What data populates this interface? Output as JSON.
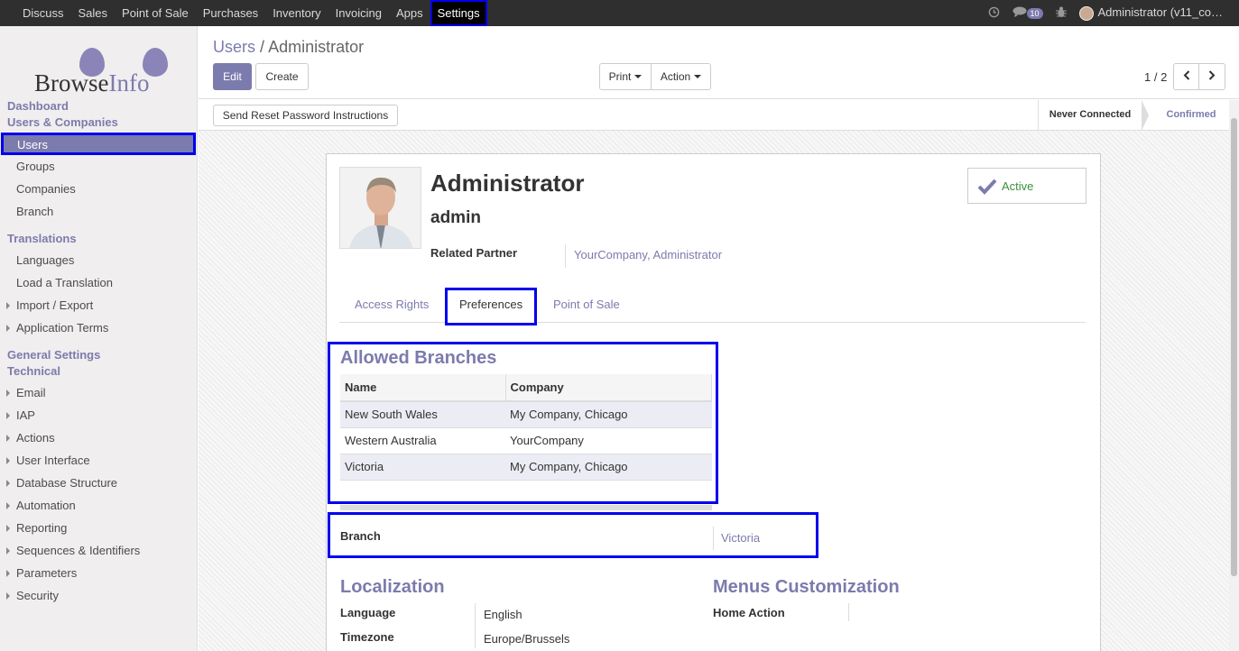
{
  "topbar": {
    "menu": [
      "Discuss",
      "Sales",
      "Point of Sale",
      "Purchases",
      "Inventory",
      "Invoicing",
      "Apps",
      "Settings"
    ],
    "active": "Settings",
    "message_count": "10",
    "user": "Administrator (v11_co…"
  },
  "logo": {
    "part1": "Browse",
    "part2": "Info"
  },
  "sidebar": {
    "dashboard": "Dashboard",
    "users_companies": "Users & Companies",
    "users": "Users",
    "groups": "Groups",
    "companies": "Companies",
    "branch": "Branch",
    "translations": "Translations",
    "languages": "Languages",
    "load_translation": "Load a Translation",
    "import_export": "Import / Export",
    "application_terms": "Application Terms",
    "general_settings": "General Settings",
    "technical": "Technical",
    "technical_items": [
      "Email",
      "IAP",
      "Actions",
      "User Interface",
      "Database Structure",
      "Automation",
      "Reporting",
      "Sequences & Identifiers",
      "Parameters",
      "Security"
    ]
  },
  "control_panel": {
    "breadcrumb_parent": "Users",
    "breadcrumb_sep": "/",
    "breadcrumb_current": "Administrator",
    "edit": "Edit",
    "create": "Create",
    "print": "Print",
    "action": "Action",
    "pager": "1 / 2"
  },
  "statusbar": {
    "reset_button": "Send Reset Password Instructions",
    "stage1": "Never Connected",
    "stage2": "Confirmed"
  },
  "form": {
    "name": "Administrator",
    "login": "admin",
    "related_partner_label": "Related Partner",
    "related_partner_value": "YourCompany, Administrator",
    "active_label": "Active",
    "tabs": [
      "Access Rights",
      "Preferences",
      "Point of Sale"
    ],
    "active_tab": "Preferences",
    "allowed_branches": {
      "title": "Allowed Branches",
      "columns": [
        "Name",
        "Company"
      ],
      "rows": [
        [
          "New South Wales",
          "My Company, Chicago"
        ],
        [
          "Western Australia",
          "YourCompany"
        ],
        [
          "Victoria",
          "My Company, Chicago"
        ]
      ]
    },
    "branch_label": "Branch",
    "branch_value": "Victoria",
    "localization_title": "Localization",
    "language_label": "Language",
    "language_value": "English",
    "timezone_label": "Timezone",
    "timezone_value": "Europe/Brussels",
    "menus_title": "Menus Customization",
    "home_action_label": "Home Action"
  }
}
